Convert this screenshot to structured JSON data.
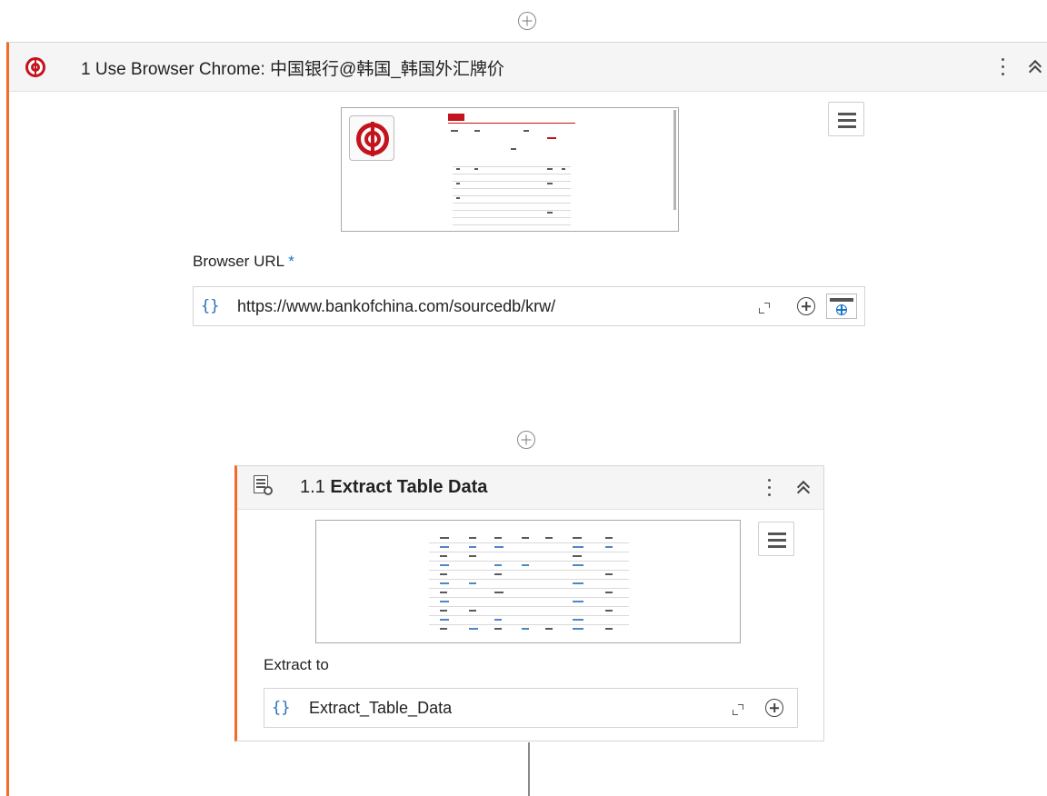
{
  "outer_activity": {
    "title": "1 Use Browser Chrome: 中国银行@韩国_韩国外汇牌价",
    "browser_url_label": "Browser URL",
    "required_marker": "*",
    "browser_url_value": "https://www.bankofchina.com/sourcedb/krw/",
    "expression_glyph": "{}"
  },
  "inner_activity": {
    "number": "1.1",
    "title": "Extract Table Data",
    "extract_to_label": "Extract to",
    "extract_to_value": "Extract_Table_Data",
    "expression_glyph": "{}"
  },
  "colors": {
    "accent": "#f26b2b",
    "brand_red": "#c3131c",
    "expression_blue": "#2a6fbd"
  }
}
